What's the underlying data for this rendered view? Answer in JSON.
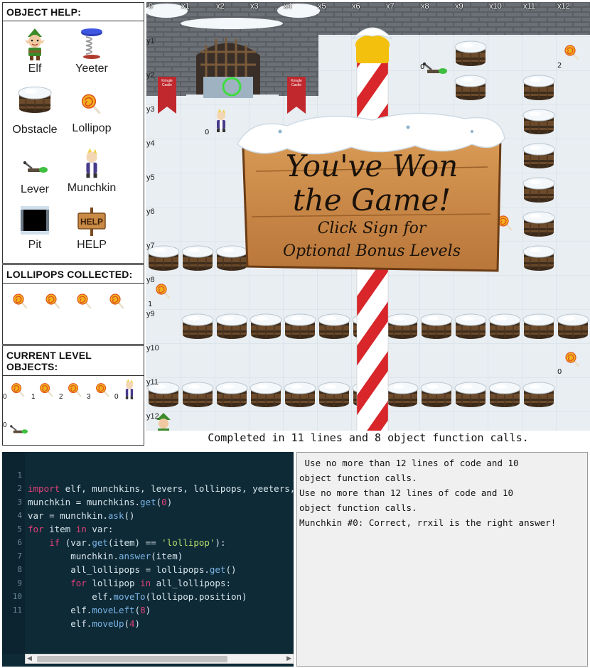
{
  "sidebar": {
    "object_help": {
      "header": "OBJECT HELP:",
      "items": [
        {
          "label": "Elf",
          "icon": "elf-icon"
        },
        {
          "label": "Yeeter",
          "icon": "yeeter-icon"
        },
        {
          "label": "Obstacle",
          "icon": "barrel-icon"
        },
        {
          "label": "Lollipop",
          "icon": "lollipop-icon"
        },
        {
          "label": "Lever",
          "icon": "lever-icon"
        },
        {
          "label": "Munchkin",
          "icon": "munchkin-icon"
        },
        {
          "label": "Pit",
          "icon": "pit-icon"
        },
        {
          "label": "HELP",
          "icon": "help-sign-icon"
        }
      ]
    },
    "lollipops_collected": {
      "header": "LOLLIPOPS COLLECTED:",
      "count_icons": 4
    },
    "current_level": {
      "header": "CURRENT LEVEL OBJECTS:",
      "objects": [
        {
          "type": "lollipop",
          "id": "0"
        },
        {
          "type": "lollipop",
          "id": "1"
        },
        {
          "type": "lollipop",
          "id": "2"
        },
        {
          "type": "lollipop",
          "id": "3"
        },
        {
          "type": "munchkin",
          "id": "0"
        },
        {
          "type": "lever",
          "id": "0"
        }
      ]
    }
  },
  "board": {
    "x_labels": [
      "0",
      "x1",
      "x2",
      "x3",
      "x4",
      "x5",
      "x6",
      "x7",
      "x8",
      "x9",
      "x10",
      "x11",
      "x12"
    ],
    "y_labels": [
      "y1",
      "y2",
      "y3",
      "y4",
      "y5",
      "y6",
      "y7",
      "y8",
      "y9",
      "y10",
      "y11",
      "y12"
    ],
    "castle_banner": "Kringle Castle",
    "object_ids": {
      "munchkin": "0",
      "lever": "0",
      "lollipop_a": "2",
      "lollipop_b": "1",
      "lollipop_c": "0"
    },
    "sign": {
      "line1": "You've Won",
      "line2": "the Game!",
      "line3": "Click Sign for",
      "line4": "Optional Bonus Levels"
    }
  },
  "status": "Completed in 11 lines and 8 object function calls.",
  "editor": {
    "line_numbers": [
      "1",
      "2",
      "3",
      "4",
      "5",
      "6",
      "7",
      "8",
      "9",
      "10",
      "11"
    ]
  },
  "console": {
    "lines": [
      " Use no more than 12 lines of code and 10",
      "object function calls.",
      "Use no more than 12 lines of code and 10",
      "object function calls.",
      "Munchkin #0: Correct, rrxil is the right answer!"
    ]
  },
  "colors": {
    "editor_bg": "#0e2a36",
    "keyword": "#e0407a",
    "function": "#7ab4e6",
    "string": "#b7dd6e",
    "sign_wood": "#c98a45",
    "pole_red": "#d8262a"
  }
}
